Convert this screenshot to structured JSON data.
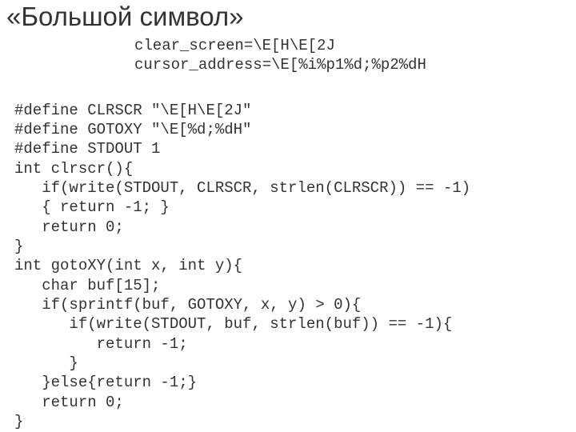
{
  "title": "«Большой символ»",
  "terminfo": {
    "line1": "clear_screen=\\E[H\\E[2J",
    "line2": "cursor_address=\\E[%i%p1%d;%p2%dH"
  },
  "code": {
    "l1": "#define CLRSCR \"\\E[H\\E[2J\"",
    "l2": "#define GOTOXY \"\\E[%d;%dH\"",
    "l3": "#define STDOUT 1",
    "l4": "int clrscr(){",
    "l5": "   if(write(STDOUT, CLRSCR, strlen(CLRSCR)) == -1)",
    "l6": "   { return -1; }",
    "l7": "   return 0;",
    "l8": "}",
    "l9": "int gotoXY(int x, int y){",
    "l10": "   char buf[15];",
    "l11": "   if(sprintf(buf, GOTOXY, x, y) > 0){",
    "l12": "      if(write(STDOUT, buf, strlen(buf)) == -1){",
    "l13": "         return -1;",
    "l14": "      }",
    "l15": "   }else{return -1;}",
    "l16": "   return 0;",
    "l17": "}"
  }
}
